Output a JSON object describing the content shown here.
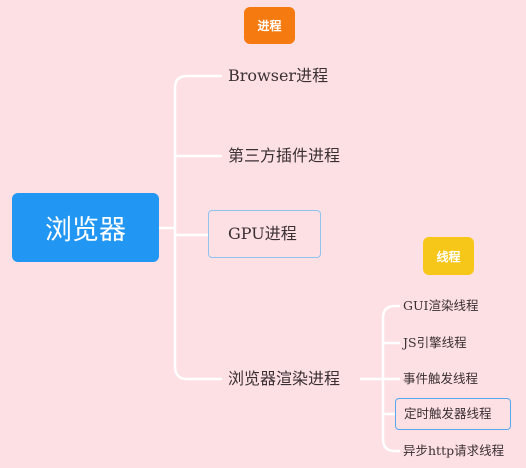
{
  "tags": {
    "process": "进程",
    "thread": "线程"
  },
  "root": {
    "label": "浏览器"
  },
  "processes": [
    {
      "label": "Browser进程"
    },
    {
      "label": "第三方插件进程"
    },
    {
      "label": "GPU进程"
    },
    {
      "label": "浏览器渲染进程"
    }
  ],
  "threads": [
    {
      "label": "GUI渲染线程"
    },
    {
      "label": "JS引擎线程"
    },
    {
      "label": "事件触发线程"
    },
    {
      "label": "定时触发器线程"
    },
    {
      "label": "异步http请求线程"
    }
  ],
  "colors": {
    "background": "#fde0e4",
    "root": "#2196f3",
    "process_tag": "#f57b11",
    "thread_tag": "#f6c619",
    "connector": "#ffffff",
    "selected_border": "#8fc3f0"
  }
}
